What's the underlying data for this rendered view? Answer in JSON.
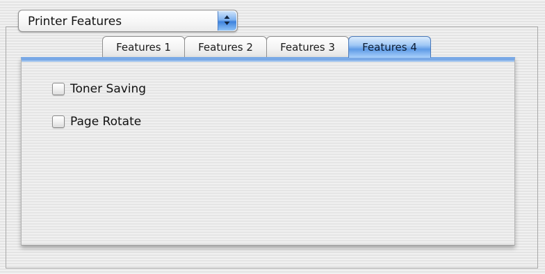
{
  "popup": {
    "selected": "Printer Features",
    "icon": "up-down-arrows-icon"
  },
  "tabs": [
    {
      "label": "Features 1",
      "selected": false
    },
    {
      "label": "Features 2",
      "selected": false
    },
    {
      "label": "Features 3",
      "selected": false
    },
    {
      "label": "Features 4",
      "selected": true
    }
  ],
  "options": [
    {
      "label": "Toner Saving",
      "checked": false
    },
    {
      "label": "Page Rotate",
      "checked": false
    }
  ],
  "colors": {
    "accent": "#5f9be6",
    "panel_top_rule": "#79a9e6"
  }
}
